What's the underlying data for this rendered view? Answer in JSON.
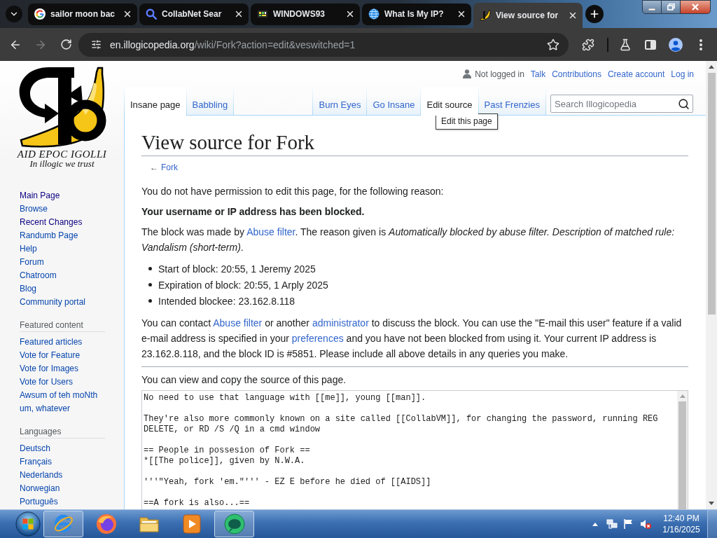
{
  "browser": {
    "tabs": [
      {
        "title": "sailor moon bac",
        "kind": "g-logo",
        "selected": false
      },
      {
        "title": "CollabNet Sear",
        "kind": "magnifier",
        "selected": false
      },
      {
        "title": "WINDOWS93",
        "kind": "pixel",
        "selected": false
      },
      {
        "title": "What Is My IP?",
        "kind": "globe",
        "selected": false
      },
      {
        "title": "View source for",
        "kind": "banana",
        "selected": true
      }
    ],
    "forward_disabled": true,
    "address": {
      "host": "en.illogicopedia.org",
      "path": "/wiki/Fork?action=edit&veswitched=1"
    }
  },
  "sidebar": {
    "logo": {
      "wordmark": "AID EPOC IGOLLI",
      "motto": "In illogic we trust"
    },
    "portals": [
      {
        "items": [
          {
            "label": "Main Page",
            "visited": true
          },
          {
            "label": "Browse",
            "visited": false
          },
          {
            "label": "Recent Changes",
            "visited": true
          },
          {
            "label": "Randumb Page",
            "visited": false
          },
          {
            "label": "Help",
            "visited": false
          },
          {
            "label": "Forum",
            "visited": false
          },
          {
            "label": "Chatroom",
            "visited": false
          },
          {
            "label": "Blog",
            "visited": false
          },
          {
            "label": "Community portal",
            "visited": false
          }
        ]
      },
      {
        "heading": "Featured content",
        "items": [
          {
            "label": "Featured articles",
            "visited": false
          },
          {
            "label": "Vote for Feature",
            "visited": false
          },
          {
            "label": "Vote for Images",
            "visited": false
          },
          {
            "label": "Vote for Users",
            "visited": false
          },
          {
            "label": "Awsum of teh moNth",
            "visited": false
          },
          {
            "label": "um, whatever",
            "visited": false
          }
        ]
      },
      {
        "heading": "Languages",
        "items": [
          {
            "label": "Deutsch",
            "visited": false
          },
          {
            "label": "Français",
            "visited": false
          },
          {
            "label": "Nederlands",
            "visited": false
          },
          {
            "label": "Norwegian",
            "visited": false
          },
          {
            "label": "Português",
            "visited": false
          }
        ]
      }
    ]
  },
  "personal_tools": {
    "status": "Not logged in",
    "links": [
      "Talk",
      "Contributions",
      "Create account",
      "Log in"
    ]
  },
  "namespace_tabs": [
    {
      "label": "Insane page",
      "selected": true
    },
    {
      "label": "Babbling",
      "selected": false
    }
  ],
  "view_tabs": [
    {
      "label": "Burn Eyes",
      "selected": false
    },
    {
      "label": "Go Insane",
      "selected": false
    },
    {
      "label": "Edit source",
      "selected": true
    },
    {
      "label": "Past Frenzies",
      "selected": false
    }
  ],
  "search": {
    "placeholder": "Search Illogicopedia"
  },
  "tooltip": "Edit this page",
  "content": {
    "title": "View source for Fork",
    "back_link": {
      "arrow": "←",
      "label": "Fork"
    },
    "intro": "You do not have permission to edit this page, for the following reason:",
    "notice": "Your username or IP address has been blocked.",
    "block_reason": [
      {
        "kind": "text",
        "text": "The block was made by "
      },
      {
        "kind": "link",
        "text": "Abuse filter"
      },
      {
        "kind": "text",
        "text": ". The reason given is *Automatically blocked by abuse filter. Description of matched rule: Vandalism (short-term)*."
      }
    ],
    "block_details": [
      "Start of block: 20:55, 1 Jeremy 2025",
      "Expiration of block: 20:55, 1 Arply 2025",
      "Intended blockee: 23.162.8.118"
    ],
    "contact": [
      {
        "kind": "text",
        "text": "You can contact "
      },
      {
        "kind": "link",
        "text": "Abuse filter"
      },
      {
        "kind": "text",
        "text": " or another "
      },
      {
        "kind": "link",
        "text": "administrator"
      },
      {
        "kind": "text",
        "text": " to discuss the block. You can use the \"E-mail this user\" feature if a valid e-mail address is specified in your "
      },
      {
        "kind": "link",
        "text": "preferences"
      },
      {
        "kind": "text",
        "text": " and you have not been blocked from using it. Your current IP address is 23.162.8.118, and the block ID is #5851. Please include all above details in any queries you make."
      }
    ],
    "source_intro": "You can view and copy the source of this page.",
    "source": [
      [
        "No need to use that language with [[me]], young [[man]]."
      ],
      [
        "They're also more commonly known on a site called [[CollabVM]], for changing the password, running REG",
        "DELETE, or RD /S /Q in a cmd window"
      ],
      [
        "== People in possesion of Fork ==",
        "*[[The police]], given by N.W.A."
      ],
      [
        "'''\"Yeah, fork 'em.\"''' - EZ E before he died of [[AIDS]]"
      ],
      [
        "==A fork is also...=="
      ]
    ]
  },
  "taskbar": {
    "apps": [
      {
        "kind": "ie",
        "running": true
      },
      {
        "kind": "firefox",
        "running": false
      },
      {
        "kind": "explorer",
        "running": false
      },
      {
        "kind": "media",
        "running": false
      },
      {
        "kind": "chat",
        "running": true
      }
    ],
    "volume_muted": true,
    "clock": {
      "time": "12:40 PM",
      "date": "1/16/2025"
    }
  }
}
